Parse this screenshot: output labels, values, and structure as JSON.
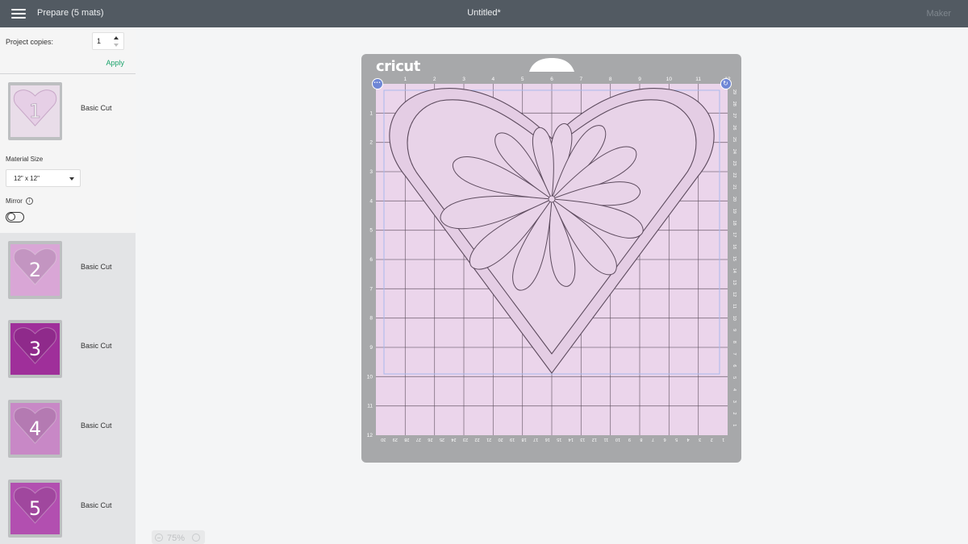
{
  "header": {
    "title": "Prepare (5 mats)",
    "document_title": "Untitled*",
    "machine": "Maker",
    "menu_icon": "hamburger-icon"
  },
  "copies": {
    "label": "Project copies:",
    "value": "1",
    "apply_label": "Apply"
  },
  "mats": [
    {
      "number": "1",
      "label": "Basic Cut",
      "color": "#e9d6ea",
      "selected": true
    },
    {
      "number": "2",
      "label": "Basic Cut",
      "color": "#d9a6d6",
      "selected": false
    },
    {
      "number": "3",
      "label": "Basic Cut",
      "color": "#9f2f9a",
      "selected": false
    },
    {
      "number": "4",
      "label": "Basic Cut",
      "color": "#c888c6",
      "selected": false
    },
    {
      "number": "5",
      "label": "Basic Cut",
      "color": "#b24fb0",
      "selected": false
    }
  ],
  "settings": {
    "material_size_label": "Material Size",
    "material_size_value": "12\" x 12\"",
    "mirror_label": "Mirror",
    "mirror_on": false
  },
  "canvas": {
    "brand": "cricut",
    "zoom": "75%",
    "top_ruler": [
      "1",
      "2",
      "3",
      "4",
      "5",
      "6",
      "7",
      "8",
      "9",
      "10",
      "11",
      "12"
    ],
    "left_ruler": [
      "1",
      "2",
      "3",
      "4",
      "5",
      "6",
      "7",
      "8",
      "9",
      "10",
      "11",
      "12"
    ],
    "bottom_ruler": [
      "30",
      "29",
      "28",
      "27",
      "26",
      "25",
      "24",
      "23",
      "22",
      "21",
      "20",
      "19",
      "18",
      "17",
      "16",
      "15",
      "14",
      "13",
      "12",
      "11",
      "10",
      "9",
      "8",
      "7",
      "6",
      "5",
      "4",
      "3",
      "2",
      "1"
    ],
    "right_ruler": [
      "29",
      "28",
      "27",
      "26",
      "25",
      "24",
      "23",
      "22",
      "21",
      "20",
      "19",
      "18",
      "17",
      "16",
      "15",
      "14",
      "13",
      "12",
      "11",
      "10",
      "9",
      "8",
      "7",
      "6",
      "5",
      "4",
      "3",
      "2",
      "1"
    ],
    "mat_color": "#ebd5eb",
    "grid_color": "#5b4e5c"
  }
}
